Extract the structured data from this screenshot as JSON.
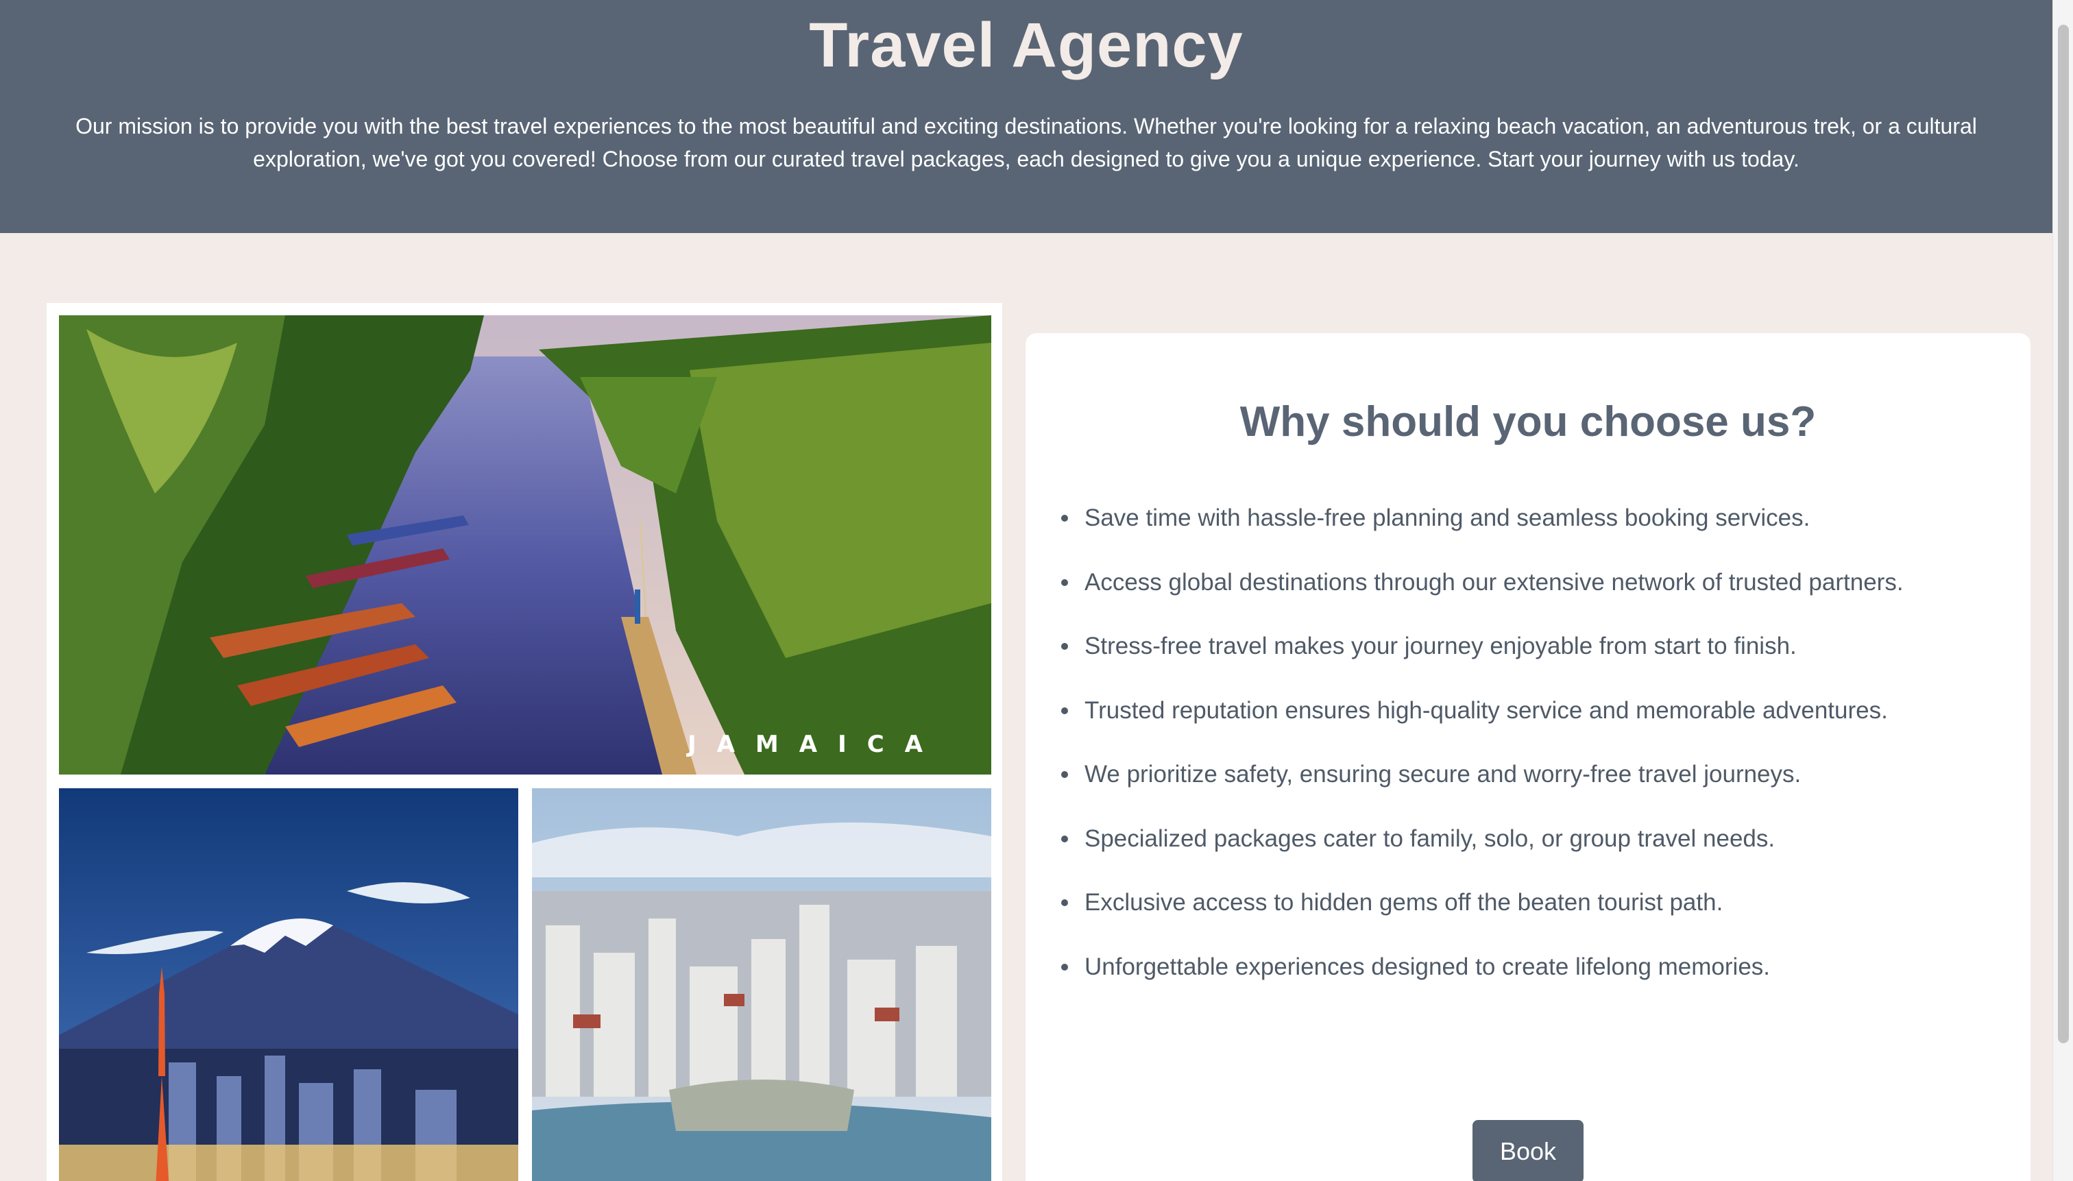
{
  "header": {
    "title": "Travel Agency",
    "mission": "Our mission is to provide you with the best travel experiences to the most beautiful and exciting destinations. Whether you're looking for a relaxing beach vacation, an adventurous trek, or a cultural exploration, we've got you covered! Choose from our curated travel packages, each designed to give you a unique experience. Start your journey with us today."
  },
  "collage": {
    "photos": [
      {
        "subject": "river-with-boats",
        "watermark": "JAMAICA"
      },
      {
        "subject": "tokyo-tower-and-mount-fuji"
      },
      {
        "subject": "city-skyline-by-lake"
      }
    ]
  },
  "why": {
    "heading": "Why should you choose us?",
    "reasons": [
      "Save time with hassle-free planning and seamless booking services.",
      "Access global destinations through our extensive network of trusted partners.",
      "Stress-free travel makes your journey enjoyable from start to finish.",
      "Trusted reputation ensures high-quality service and memorable adventures.",
      "We prioritize safety, ensuring secure and worry-free travel journeys.",
      "Specialized packages cater to family, solo, or group travel needs.",
      "Exclusive access to hidden gems off the beaten tourist path.",
      "Unforgettable experiences designed to create lifelong memories."
    ],
    "book_label": "Book"
  },
  "colors": {
    "header_bg": "#596574",
    "page_bg": "#f2ebe8",
    "accent": "#596574",
    "text": "#4f5a67"
  }
}
